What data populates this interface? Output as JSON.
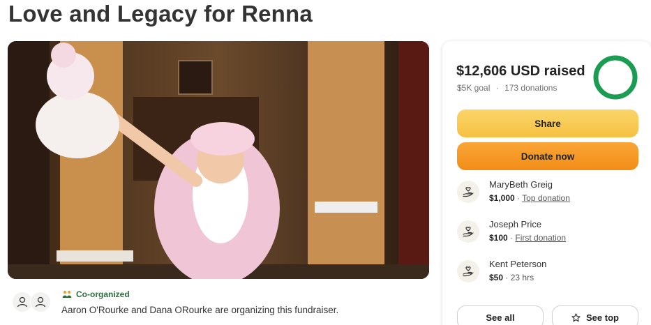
{
  "title": "Love and Legacy for Renna",
  "organizer": {
    "badge": "Co-organized",
    "text": "Aaron O'Rourke and Dana ORourke are organizing this fundraiser."
  },
  "sidebar": {
    "raised": "$12,606 USD raised",
    "goal": "$5K goal",
    "separator": "·",
    "donations": "173 donations",
    "progress_fraction": 1.0,
    "share_label": "Share",
    "donate_label": "Donate now",
    "donors": [
      {
        "name": "MaryBeth Greig",
        "amount": "$1,000",
        "note": "Top donation"
      },
      {
        "name": "Joseph Price",
        "amount": "$100",
        "note": "First donation"
      },
      {
        "name": "Kent Peterson",
        "amount": "$50",
        "note": "23 hrs"
      }
    ],
    "see_all_label": "See all",
    "see_top_label": "See top"
  },
  "colors": {
    "progress": "#1a9c52",
    "share_button": "#f6c142",
    "donate_button": "#f28d17",
    "co_badge": "#2f6a3c"
  }
}
